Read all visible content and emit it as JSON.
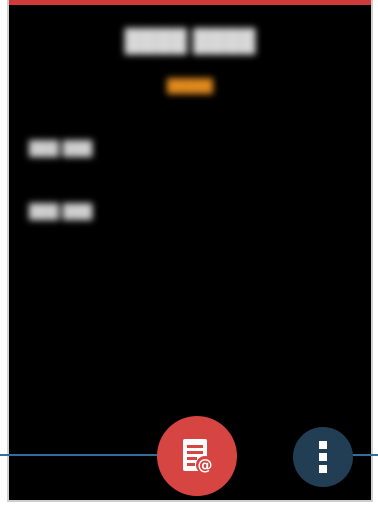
{
  "screen": {
    "accent_bar_color": "#cf3b3b",
    "background_color": "#000000"
  },
  "buttons": {
    "email_report": {
      "icon": "email-report-icon",
      "color": "#d64541"
    },
    "more_options": {
      "icon": "more-vertical-icon",
      "color": "#213e55"
    }
  },
  "callouts": {
    "line_color": "#2e6f9e"
  }
}
